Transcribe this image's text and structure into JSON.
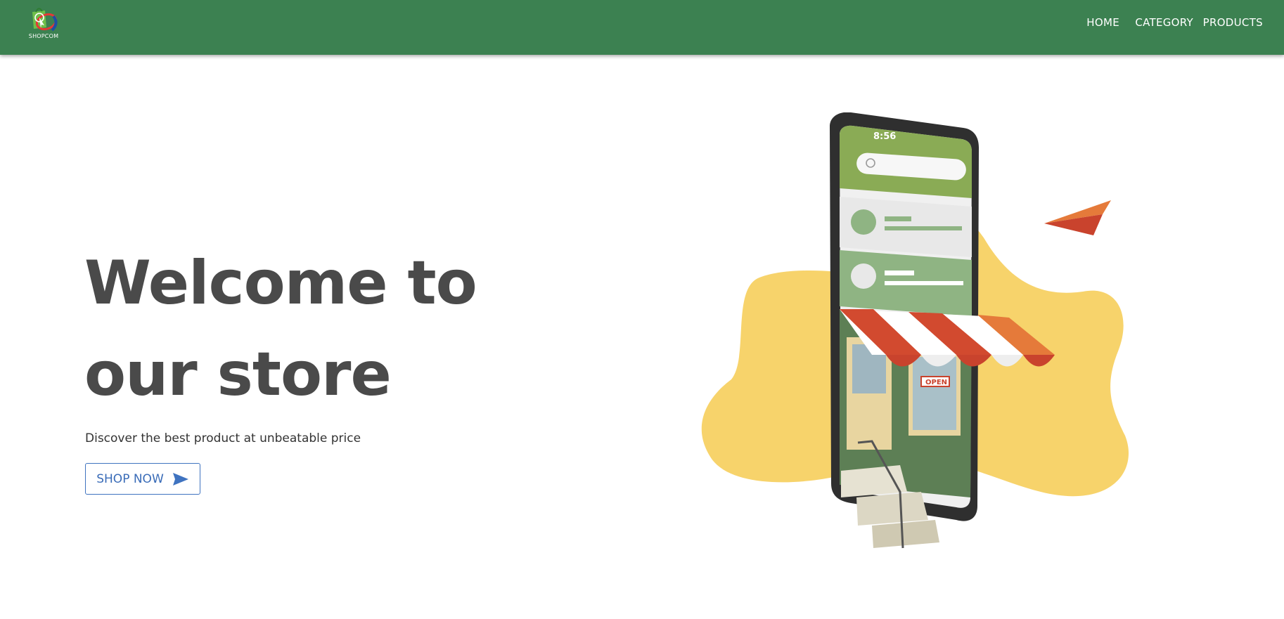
{
  "brand": {
    "logo_text": "SHOPCOM",
    "color": "#3c8151"
  },
  "nav": {
    "home": "HOME",
    "category": "CATEGORY",
    "products": "PRODUCTS"
  },
  "hero": {
    "title": "Welcome to our store",
    "subtitle": "Discover the best product at unbeatable price",
    "cta_label": "SHOP NOW",
    "cta_color": "#3f73c0"
  },
  "illustration": {
    "phone_time": "8:56",
    "shop_sign": "OPEN",
    "blob_color": "#f7d36b",
    "screen_color": "#8aab55"
  }
}
